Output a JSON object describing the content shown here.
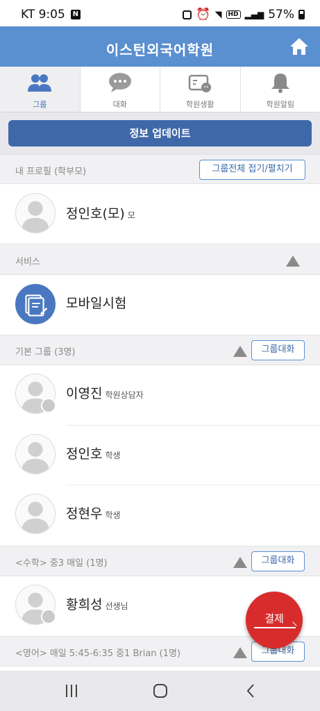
{
  "status_bar": {
    "carrier_time": "KT 9:05",
    "notification_letter": "N",
    "hd": "HD",
    "battery": "57%"
  },
  "app": {
    "title": "이스턴외국어학원"
  },
  "tabs": [
    {
      "label": "그룹",
      "icon": "group-icon",
      "active": true
    },
    {
      "label": "대화",
      "icon": "chat-bubble-icon",
      "active": false
    },
    {
      "label": "학원생활",
      "icon": "board-icon",
      "active": false
    },
    {
      "label": "학원알림",
      "icon": "bell-icon",
      "active": false
    }
  ],
  "update_button": "정보 업데이트",
  "sections": {
    "profile": {
      "title": "내 프로필 (학부모)",
      "button": "그룹전체 접기/펼치기"
    },
    "service": {
      "title": "서비스"
    },
    "basic": {
      "title": "기본 그룹 (3명)",
      "button": "그룹대화"
    },
    "math": {
      "title": "<수학> 중3 매일 (1명)",
      "button": "그룹대화"
    },
    "english": {
      "title": "<영어> 매일 5:45-6:35 중1 Brian (1명)",
      "button": "그룹대화"
    }
  },
  "rows": {
    "profile": {
      "name": "정인호(모)",
      "role": "모"
    },
    "service": {
      "name": "모바일시험"
    },
    "basic": [
      {
        "name": "이영진",
        "role": "학원상담자"
      },
      {
        "name": "정인호",
        "role": "학생"
      },
      {
        "name": "정현우",
        "role": "학생"
      }
    ],
    "math": [
      {
        "name": "황희성",
        "role": "선생님"
      }
    ]
  },
  "fab": {
    "label": "결제"
  },
  "colors": {
    "primary": "#5a8fd0",
    "primary_dark": "#3f68a8",
    "fab": "#d82c2c"
  }
}
